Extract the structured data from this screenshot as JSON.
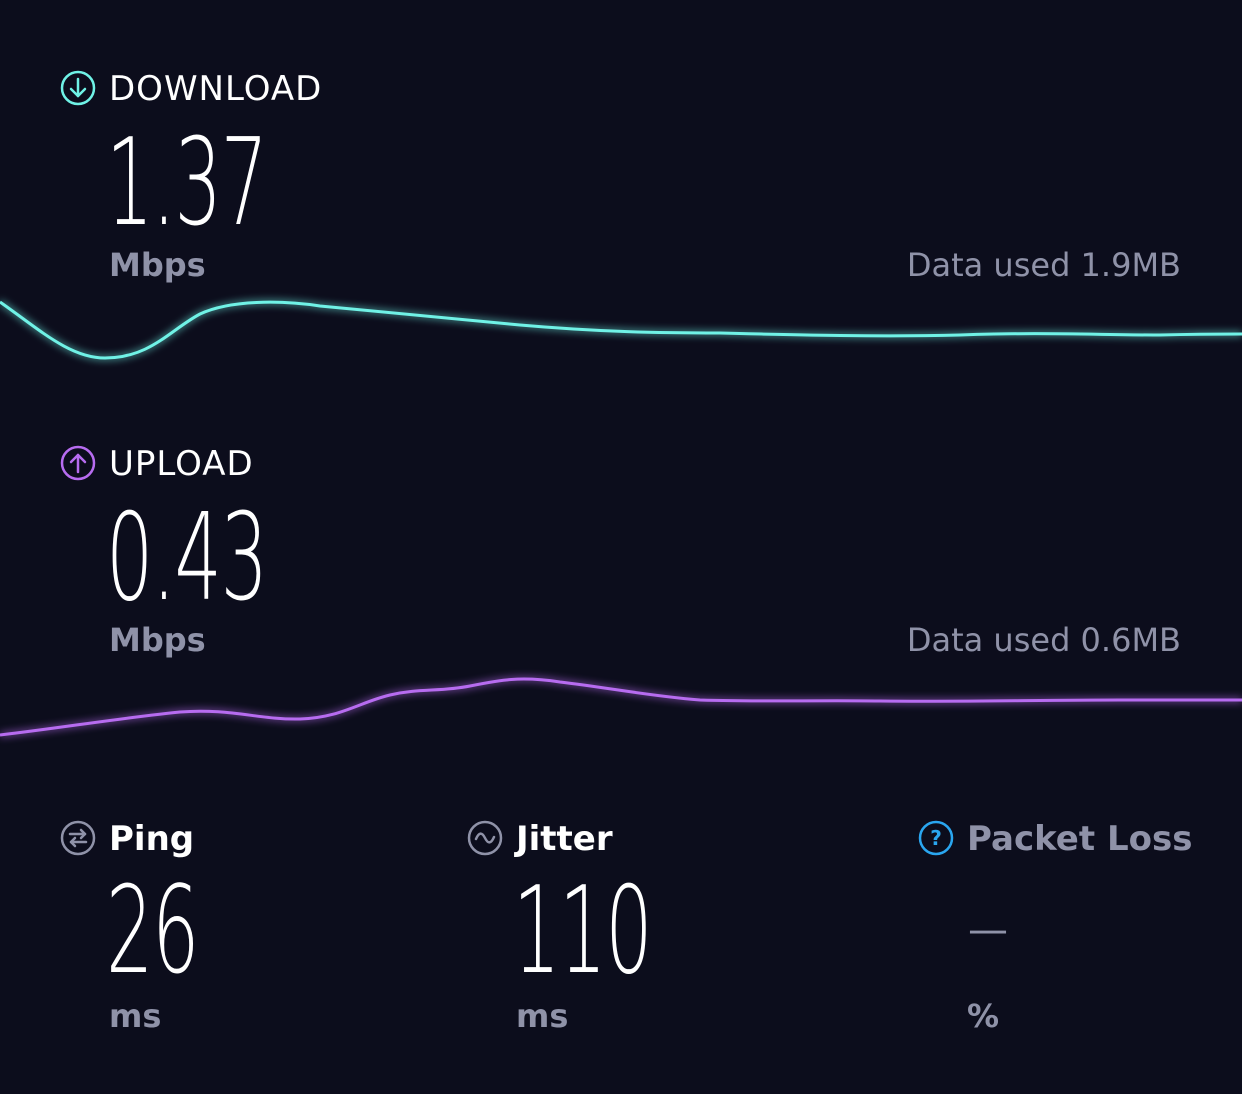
{
  "download": {
    "label": "DOWNLOAD",
    "icon": "download-arrow-icon",
    "value": "1.37",
    "unit": "Mbps",
    "data_used": "Data used 1.9MB",
    "color": "#6ff2e6"
  },
  "upload": {
    "label": "UPLOAD",
    "icon": "upload-arrow-icon",
    "value": "0.43",
    "unit": "Mbps",
    "data_used": "Data used 0.6MB",
    "color": "#b76cf0"
  },
  "ping": {
    "label": "Ping",
    "icon": "ping-icon",
    "value": "26",
    "unit": "ms"
  },
  "jitter": {
    "label": "Jitter",
    "icon": "jitter-icon",
    "value": "110",
    "unit": "ms"
  },
  "packet_loss": {
    "label": "Packet Loss",
    "icon": "help-question-icon",
    "value": "—",
    "unit": "%",
    "icon_color": "#2aa6f0"
  }
}
